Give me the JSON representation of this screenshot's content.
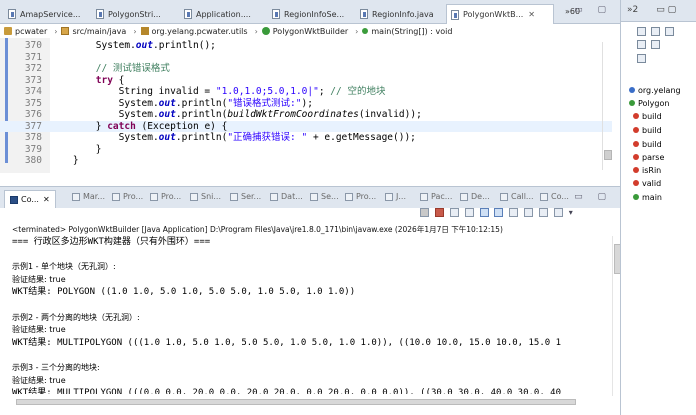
{
  "editor_tabs": [
    {
      "label": "AmapService...",
      "active": false
    },
    {
      "label": "PolygonStri...",
      "active": false
    },
    {
      "label": "Application....",
      "active": false
    },
    {
      "label": "RegionInfoSe...",
      "active": false
    },
    {
      "label": "RegionInfo.java",
      "active": false
    },
    {
      "label": "PolygonWktB...",
      "active": true
    }
  ],
  "tab_overflow": "»60",
  "breadcrumb": {
    "project": "pcwater",
    "source": "src/main/java",
    "package": "org.yelang.pcwater.utils",
    "class": "PolygonWktBuilder",
    "method": "main(String[]) : void"
  },
  "code_lines": [
    {
      "n": "370",
      "segments": [
        {
          "t": "        System.",
          "c": ""
        },
        {
          "t": "out",
          "c": "fld"
        },
        {
          "t": ".println();",
          "c": ""
        }
      ]
    },
    {
      "n": "371",
      "segments": []
    },
    {
      "n": "372",
      "segments": [
        {
          "t": "        // 测试错误格式",
          "c": "cmt"
        }
      ]
    },
    {
      "n": "373",
      "segments": [
        {
          "t": "        ",
          "c": ""
        },
        {
          "t": "try",
          "c": "kw"
        },
        {
          "t": " {",
          "c": ""
        }
      ]
    },
    {
      "n": "374",
      "segments": [
        {
          "t": "            String invalid = ",
          "c": ""
        },
        {
          "t": "\"1.0,1.0;5.0,1.0|\"",
          "c": "str"
        },
        {
          "t": "; ",
          "c": ""
        },
        {
          "t": "// 空的地块",
          "c": "cmt"
        }
      ]
    },
    {
      "n": "375",
      "segments": [
        {
          "t": "            System.",
          "c": ""
        },
        {
          "t": "out",
          "c": "fld"
        },
        {
          "t": ".println(",
          "c": ""
        },
        {
          "t": "\"错误格式测试:\"",
          "c": "str"
        },
        {
          "t": ");",
          "c": ""
        }
      ]
    },
    {
      "n": "376",
      "segments": [
        {
          "t": "            System.",
          "c": ""
        },
        {
          "t": "out",
          "c": "fld"
        },
        {
          "t": ".println(",
          "c": ""
        },
        {
          "t": "buildWktFromCoordinates",
          "c": "it"
        },
        {
          "t": "(invalid));",
          "c": ""
        }
      ]
    },
    {
      "n": "377",
      "segments": [
        {
          "t": "        } ",
          "c": ""
        },
        {
          "t": "catch",
          "c": "kw"
        },
        {
          "t": " (Exception e) {",
          "c": ""
        }
      ]
    },
    {
      "n": "378",
      "segments": [
        {
          "t": "            System.",
          "c": ""
        },
        {
          "t": "out",
          "c": "fld"
        },
        {
          "t": ".println(",
          "c": ""
        },
        {
          "t": "\"正确捕获错误: \"",
          "c": "str"
        },
        {
          "t": " + e.getMessage());",
          "c": ""
        }
      ]
    },
    {
      "n": "379",
      "segments": [
        {
          "t": "        }",
          "c": ""
        }
      ]
    },
    {
      "n": "380",
      "segments": [
        {
          "t": "    }",
          "c": ""
        }
      ]
    }
  ],
  "console_tabs": [
    {
      "label": "Co...",
      "active": true
    },
    {
      "label": "Mar...",
      "active": false
    },
    {
      "label": "Pro...",
      "active": false
    },
    {
      "label": "Pro...",
      "active": false
    },
    {
      "label": "Sni...",
      "active": false
    },
    {
      "label": "Ser...",
      "active": false
    },
    {
      "label": "Dat...",
      "active": false
    },
    {
      "label": "Se...",
      "active": false
    },
    {
      "label": "Pro...",
      "active": false
    },
    {
      "label": "J...",
      "active": false
    },
    {
      "label": "Pac...",
      "active": false
    },
    {
      "label": "De...",
      "active": false
    },
    {
      "label": "Call...",
      "active": false
    },
    {
      "label": "Co...",
      "active": false
    }
  ],
  "console_status": "<terminated> PolygonWktBuilder [Java Application] D:\\Program Files\\Java\\jre1.8.0_171\\bin\\javaw.exe (2026年1月7日 下午10:12:15)",
  "console_lines": [
    {
      "text": "=== 行政区多边形WKT构建器（只有外围环）===",
      "small": false
    },
    {
      "text": "",
      "small": false
    },
    {
      "text": "示例1 - 单个地块（无孔洞）:",
      "small": true
    },
    {
      "text": "验证结果: true",
      "small": true
    },
    {
      "text": "WKT结果: POLYGON ((1.0 1.0, 5.0 1.0, 5.0 5.0, 1.0 5.0, 1.0 1.0))",
      "small": false
    },
    {
      "text": "",
      "small": false
    },
    {
      "text": "示例2 - 两个分离的地块（无孔洞）:",
      "small": true
    },
    {
      "text": "验证结果: true",
      "small": true
    },
    {
      "text": "WKT结果: MULTIPOLYGON (((1.0 1.0, 5.0 1.0, 5.0 5.0, 1.0 5.0, 1.0 1.0)), ((10.0 10.0, 15.0 10.0, 15.0 1",
      "small": false
    },
    {
      "text": "",
      "small": false
    },
    {
      "text": "示例3 - 三个分离的地块:",
      "small": true
    },
    {
      "text": "验证结果: true",
      "small": true
    },
    {
      "text": "WKT结果: MULTIPOLYGON (((0.0 0.0, 20.0 0.0, 20.0 20.0, 0.0 20.0, 0.0 0.0)), ((30.0 30.0, 40.0 30.0, 40",
      "small": false
    }
  ],
  "right_panel": {
    "header": "»2",
    "items": [
      {
        "label": "org.yelang",
        "dot": "blue"
      },
      {
        "label": "Polygon",
        "dot": "green"
      },
      {
        "label": "build",
        "dot": "red"
      },
      {
        "label": "build",
        "dot": "red"
      },
      {
        "label": "build",
        "dot": "red"
      },
      {
        "label": "parse",
        "dot": "red"
      },
      {
        "label": "isRin",
        "dot": "red"
      },
      {
        "label": "valid",
        "dot": "red"
      },
      {
        "label": "main",
        "dot": "green"
      }
    ]
  }
}
